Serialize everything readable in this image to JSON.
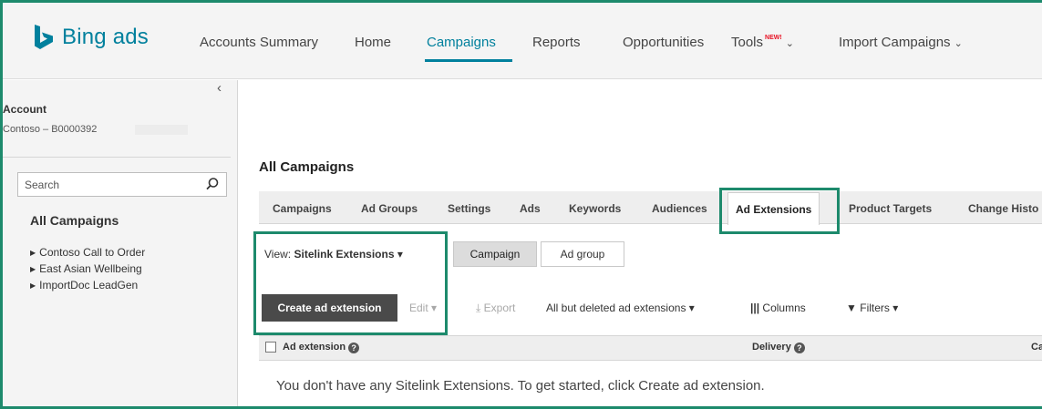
{
  "brand": {
    "name": "Bing ads",
    "color": "#00809d",
    "logo_icon": "bing-logo-icon"
  },
  "accent_highlight_color": "#1d8a6c",
  "nav": {
    "items": [
      {
        "label": "Accounts Summary"
      },
      {
        "label": "Home"
      },
      {
        "label": "Campaigns",
        "active": true
      },
      {
        "label": "Reports"
      },
      {
        "label": "Opportunities"
      },
      {
        "label": "Tools",
        "badge": "NEW!",
        "dropdown": true
      },
      {
        "label": "Import Campaigns",
        "dropdown": true
      }
    ]
  },
  "sidebar": {
    "collapse_icon": "chevron-left-icon",
    "account_label": "Account",
    "account_value": "Contoso – B0000392",
    "search_placeholder": "Search",
    "heading": "All Campaigns",
    "campaigns": [
      {
        "label": "Contoso Call to Order"
      },
      {
        "label": "East Asian Wellbeing"
      },
      {
        "label": "ImportDoc LeadGen"
      }
    ]
  },
  "main": {
    "title": "All Campaigns",
    "tabs": [
      {
        "label": "Campaigns"
      },
      {
        "label": "Ad Groups"
      },
      {
        "label": "Settings"
      },
      {
        "label": "Ads"
      },
      {
        "label": "Keywords"
      },
      {
        "label": "Audiences"
      },
      {
        "label": "Ad Extensions",
        "active": true
      },
      {
        "label": "Product Targets"
      },
      {
        "label": "Change Histo"
      }
    ],
    "view": {
      "prefix": "View:",
      "value": "Sitelink Extensions"
    },
    "level_toggle": {
      "options": [
        "Campaign",
        "Ad group"
      ],
      "selected": "Campaign"
    },
    "toolbar": {
      "create": "Create ad extension",
      "edit": "Edit",
      "export": "Export",
      "filter_status": "All but deleted ad extensions",
      "columns": "Columns",
      "filters": "Filters"
    },
    "table": {
      "columns": [
        "Ad extension",
        "Delivery",
        "Ca"
      ]
    },
    "empty_message": "You don't have any Sitelink Extensions. To get started, click Create ad extension."
  }
}
